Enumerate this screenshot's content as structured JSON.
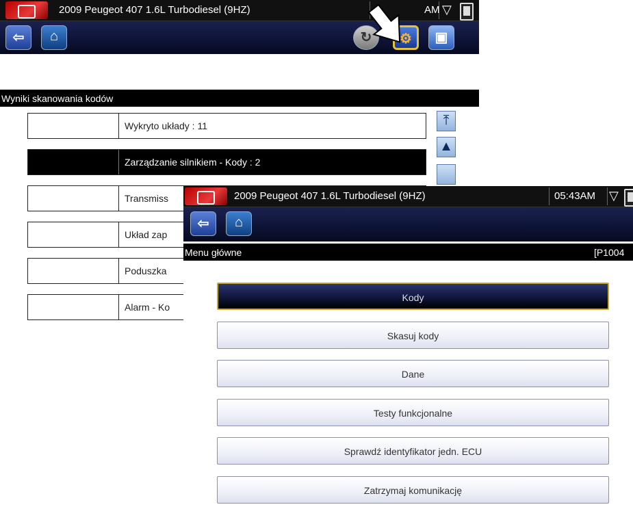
{
  "back_screen": {
    "vehicle_title": "2009 Peugeot 407 1.6L Turbodiesel (9HZ)",
    "clock_partial": "AM",
    "subtitle": "Wyniki skanowania kodów",
    "rows": [
      {
        "label": "Wykryto układy : 11"
      },
      {
        "label": "Zarządzanie silnikiem - Kody : 2"
      },
      {
        "label": "Transmiss"
      },
      {
        "label": "Układ zap"
      },
      {
        "label": "Poduszka"
      },
      {
        "label": "Alarm - Ko"
      }
    ],
    "selected_row": 1
  },
  "front_screen": {
    "vehicle_title": "2009 Peugeot 407 1.6L Turbodiesel (9HZ)",
    "clock": "05:43AM",
    "subtitle": "Menu główne",
    "code_partial": "[P1004",
    "menu": [
      {
        "label": "Kody"
      },
      {
        "label": "Skasuj kody"
      },
      {
        "label": "Dane"
      },
      {
        "label": "Testy funkcjonalne"
      },
      {
        "label": "Sprawdź identyfikator jedn. ECU"
      },
      {
        "label": "Zatrzymaj komunikację"
      }
    ],
    "selected_item": 0
  },
  "icons": {
    "back": "back-arrow-icon",
    "home": "home-icon",
    "scan": "scan-cycle-icon",
    "vehicle_system": "vehicle-system-icon",
    "save": "save-icon",
    "wifi": "wifi-icon",
    "battery": "battery-icon",
    "scroll_top": "scroll-top-icon",
    "scroll_up": "scroll-up-icon"
  },
  "colors": {
    "selected_border": "#e4c233",
    "selected_row": "#000000",
    "toolbar": "#0d1335"
  }
}
